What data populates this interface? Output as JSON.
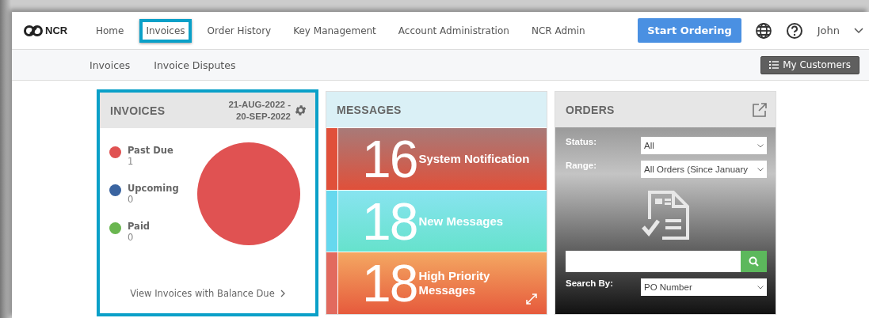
{
  "nav": {
    "items": [
      {
        "label": "Home",
        "selected": false
      },
      {
        "label": "Invoices",
        "selected": true
      },
      {
        "label": "Order History",
        "selected": false
      },
      {
        "label": "Key Management",
        "selected": false
      },
      {
        "label": "Account Administration",
        "selected": false
      },
      {
        "label": "NCR Admin",
        "selected": false
      }
    ],
    "logo": "NCR",
    "cta": "Start Ordering",
    "user": "John"
  },
  "subnav": {
    "items": [
      "Invoices",
      "Invoice Disputes"
    ],
    "button": "My Customers"
  },
  "invoices": {
    "title": "INVOICES",
    "date_range": [
      "21-AUG-2022 -",
      "20-SEP-2022"
    ],
    "legend": [
      {
        "count": "1",
        "color": "#e05252"
      },
      {
        "count": "0",
        "color": "#3a64a0"
      },
      {
        "count": "0",
        "color": "#6ab650"
      }
    ],
    "chart_data": {
      "type": "pie",
      "categories": [
        "Past Due",
        "Upcoming",
        "Paid"
      ],
      "values": [
        1,
        0,
        0
      ]
    },
    "link": "View Invoices with Balance Due"
  },
  "messages": {
    "title": "MESSAGES",
    "tiles": [
      {
        "kind": "system",
        "count": "16",
        "label": "System Notification"
      },
      {
        "kind": "new",
        "count": "18",
        "label": "New Messages"
      },
      {
        "kind": "priority",
        "count": "18",
        "label": "High Priority Messages"
      }
    ]
  },
  "orders": {
    "title": "ORDERS",
    "filters": [
      {
        "label": "Status:",
        "value": "All"
      },
      {
        "label": "Range:",
        "value": "All Orders (Since January"
      }
    ],
    "search_by": {
      "label": "Search By:",
      "value": "PO Number"
    }
  }
}
